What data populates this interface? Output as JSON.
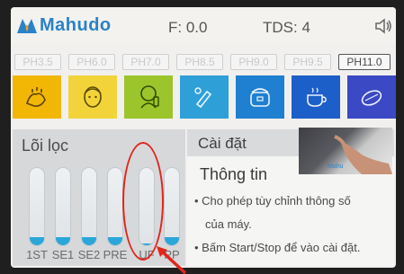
{
  "header": {
    "brand": "Mahudo",
    "flow_label": "F: 0.0",
    "tds_label": "TDS: 4",
    "speaker_icon": "speaker-icon"
  },
  "ph_levels": [
    {
      "label": "PH3.5",
      "active": false
    },
    {
      "label": "PH6.0",
      "active": false
    },
    {
      "label": "PH7.0",
      "active": false
    },
    {
      "label": "PH8.5",
      "active": false
    },
    {
      "label": "PH9.0",
      "active": false
    },
    {
      "label": "PH9.5",
      "active": false
    },
    {
      "label": "PH11.0",
      "active": true
    }
  ],
  "tiles": [
    {
      "icon": "hand-wash-icon",
      "color": "#f2b705"
    },
    {
      "icon": "face-care-icon",
      "color": "#f2d43a"
    },
    {
      "icon": "baby-icon",
      "color": "#9bc52a"
    },
    {
      "icon": "medicine-icon",
      "color": "#2f9fd8"
    },
    {
      "icon": "rice-cooker-icon",
      "color": "#1f7fd0"
    },
    {
      "icon": "tea-cup-icon",
      "color": "#1d5fc9"
    },
    {
      "icon": "vegetables-icon",
      "color": "#3b49c4"
    }
  ],
  "filter_panel": {
    "title": "Lõi lọc",
    "filters": [
      {
        "label": "1ST",
        "level": 0.1
      },
      {
        "label": "SE1",
        "level": 0.1
      },
      {
        "label": "SE2",
        "level": 0.1
      },
      {
        "label": "PRE",
        "level": 0.1
      },
      {
        "label": "UF",
        "level": 0.02
      },
      {
        "label": "PP",
        "level": 0.1
      }
    ]
  },
  "settings_panel": {
    "title": "Cài đặt",
    "info_title": "Thông tin",
    "lines": [
      "• Cho phép tùy chỉnh thông số",
      "của máy.",
      "• Bấm Start/Stop để vào cài đặt."
    ],
    "photo_text": "Mahu"
  },
  "colors": {
    "accent": "#2a82c8",
    "filter_fill": "#2aa7d8",
    "annotation": "#e0261d"
  }
}
